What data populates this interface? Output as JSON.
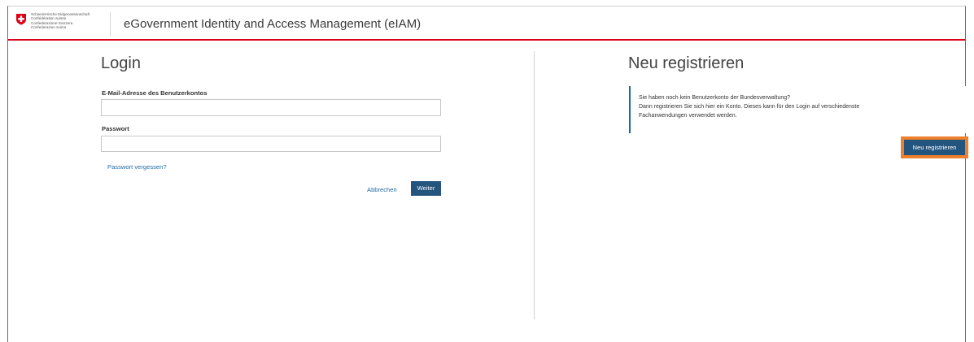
{
  "header": {
    "confederation_lines": [
      "Schweizerische Eidgenossenschaft",
      "Confédération suisse",
      "Confederazione Svizzera",
      "Confederaziun svizra"
    ],
    "app_title": "eGovernment Identity and Access Management (eIAM)"
  },
  "login": {
    "title": "Login",
    "email_label": "E-Mail-Adresse des Benutzerkontos",
    "email_value": "",
    "password_label": "Passwort",
    "password_value": "",
    "forgot_password": "Passwort vergessen?",
    "cancel": "Abbrechen",
    "next": "Weiter"
  },
  "register": {
    "title": "Neu registrieren",
    "info_lines": [
      "Sie haben noch kein Benutzerkonto der Bundesverwaltung?",
      "Dann registrieren Sie sich hier ein Konto. Dieses kann für den Login auf verschiedenste",
      "Fachanwendungen verwendet werden."
    ],
    "button": "Neu registrieren"
  },
  "colors": {
    "brand_red": "#dc0018",
    "primary_button": "#24557e",
    "link": "#1f6ba8",
    "highlight": "#ee7f2d"
  },
  "icons": {
    "crest": "swiss-crest-icon"
  }
}
